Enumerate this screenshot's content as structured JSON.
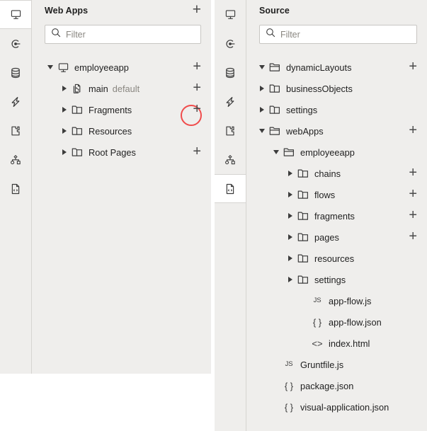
{
  "rails": {
    "left": {
      "items": [
        {
          "icon": "monitor-icon",
          "selected": true
        },
        {
          "icon": "target-icon",
          "selected": false
        },
        {
          "icon": "database-icon",
          "selected": false
        },
        {
          "icon": "lightning-icon",
          "selected": false
        },
        {
          "icon": "puzzle-icon",
          "selected": false
        },
        {
          "icon": "hierarchy-icon",
          "selected": false
        },
        {
          "icon": "source-file-icon",
          "selected": false
        }
      ]
    },
    "right": {
      "items": [
        {
          "icon": "monitor-icon",
          "selected": false
        },
        {
          "icon": "target-icon",
          "selected": false
        },
        {
          "icon": "database-icon",
          "selected": false
        },
        {
          "icon": "lightning-icon",
          "selected": false
        },
        {
          "icon": "puzzle-icon",
          "selected": false
        },
        {
          "icon": "hierarchy-icon",
          "selected": false
        },
        {
          "icon": "source-file-icon",
          "selected": true
        }
      ]
    }
  },
  "web_apps": {
    "title": "Web Apps",
    "add_label": "+",
    "filter": {
      "value": "",
      "placeholder": "Filter",
      "icon": "search-icon"
    },
    "tree": [
      {
        "label": "employeeapp",
        "sub": "",
        "indent": 0,
        "twisty": "open",
        "icon": "monitor-icon",
        "plus": true,
        "highlight": false
      },
      {
        "label": "main",
        "sub": "default",
        "indent": 1,
        "twisty": "closed",
        "icon": "page-flow-icon",
        "plus": true,
        "highlight": false
      },
      {
        "label": "Fragments",
        "sub": "",
        "indent": 1,
        "twisty": "closed",
        "icon": "folder-icon",
        "plus": true,
        "highlight": true
      },
      {
        "label": "Resources",
        "sub": "",
        "indent": 1,
        "twisty": "closed",
        "icon": "folder-icon",
        "plus": false,
        "highlight": false
      },
      {
        "label": "Root Pages",
        "sub": "",
        "indent": 1,
        "twisty": "closed",
        "icon": "folder-icon",
        "plus": true,
        "highlight": false
      }
    ]
  },
  "source": {
    "title": "Source",
    "filter": {
      "value": "",
      "placeholder": "Filter",
      "icon": "search-icon"
    },
    "tree": [
      {
        "label": "dynamicLayouts",
        "indent": 0,
        "twisty": "open",
        "icon": "folder-open-icon",
        "plus": true,
        "highlight": false
      },
      {
        "label": "businessObjects",
        "indent": 0,
        "twisty": "closed",
        "icon": "folder-icon",
        "plus": false,
        "highlight": false
      },
      {
        "label": "settings",
        "indent": 0,
        "twisty": "closed",
        "icon": "folder-icon",
        "plus": false,
        "highlight": false
      },
      {
        "label": "webApps",
        "indent": 0,
        "twisty": "open",
        "icon": "folder-open-icon",
        "plus": true,
        "highlight": false
      },
      {
        "label": "employeeapp",
        "indent": 1,
        "twisty": "open",
        "icon": "folder-open-icon",
        "plus": false,
        "highlight": false
      },
      {
        "label": "chains",
        "indent": 2,
        "twisty": "closed",
        "icon": "folder-icon",
        "plus": true,
        "highlight": false
      },
      {
        "label": "flows",
        "indent": 2,
        "twisty": "closed",
        "icon": "folder-icon",
        "plus": true,
        "highlight": false
      },
      {
        "label": "fragments",
        "indent": 2,
        "twisty": "closed",
        "icon": "folder-icon",
        "plus": true,
        "highlight": true
      },
      {
        "label": "pages",
        "indent": 2,
        "twisty": "closed",
        "icon": "folder-icon",
        "plus": true,
        "highlight": false
      },
      {
        "label": "resources",
        "indent": 2,
        "twisty": "closed",
        "icon": "folder-icon",
        "plus": false,
        "highlight": false
      },
      {
        "label": "settings",
        "indent": 2,
        "twisty": "closed",
        "icon": "folder-icon",
        "plus": false,
        "highlight": false
      },
      {
        "label": "app-flow.js",
        "indent": 3,
        "twisty": "none",
        "icon": "js-file-icon",
        "plus": false,
        "highlight": false
      },
      {
        "label": "app-flow.json",
        "indent": 3,
        "twisty": "none",
        "icon": "json-file-icon",
        "plus": false,
        "highlight": false
      },
      {
        "label": "index.html",
        "indent": 3,
        "twisty": "none",
        "icon": "html-file-icon",
        "plus": false,
        "highlight": false
      },
      {
        "label": "Gruntfile.js",
        "indent": 1,
        "twisty": "none",
        "icon": "js-file-icon",
        "plus": false,
        "highlight": false
      },
      {
        "label": "package.json",
        "indent": 1,
        "twisty": "none",
        "icon": "json-file-icon",
        "plus": false,
        "highlight": false
      },
      {
        "label": "visual-application.json",
        "indent": 1,
        "twisty": "none",
        "icon": "json-file-icon",
        "plus": false,
        "highlight": false
      }
    ]
  },
  "glyphs": {
    "js": "JS",
    "json": "{ }",
    "html": "<>"
  },
  "colors": {
    "panel_bg": "#efeeec",
    "selected_bg": "#ffffff",
    "border": "#d6d4d1",
    "text": "#1f1f1f",
    "muted_text": "#8a8781",
    "highlight_ring": "#f04b4b",
    "icon_stroke": "#3c3c3c"
  }
}
